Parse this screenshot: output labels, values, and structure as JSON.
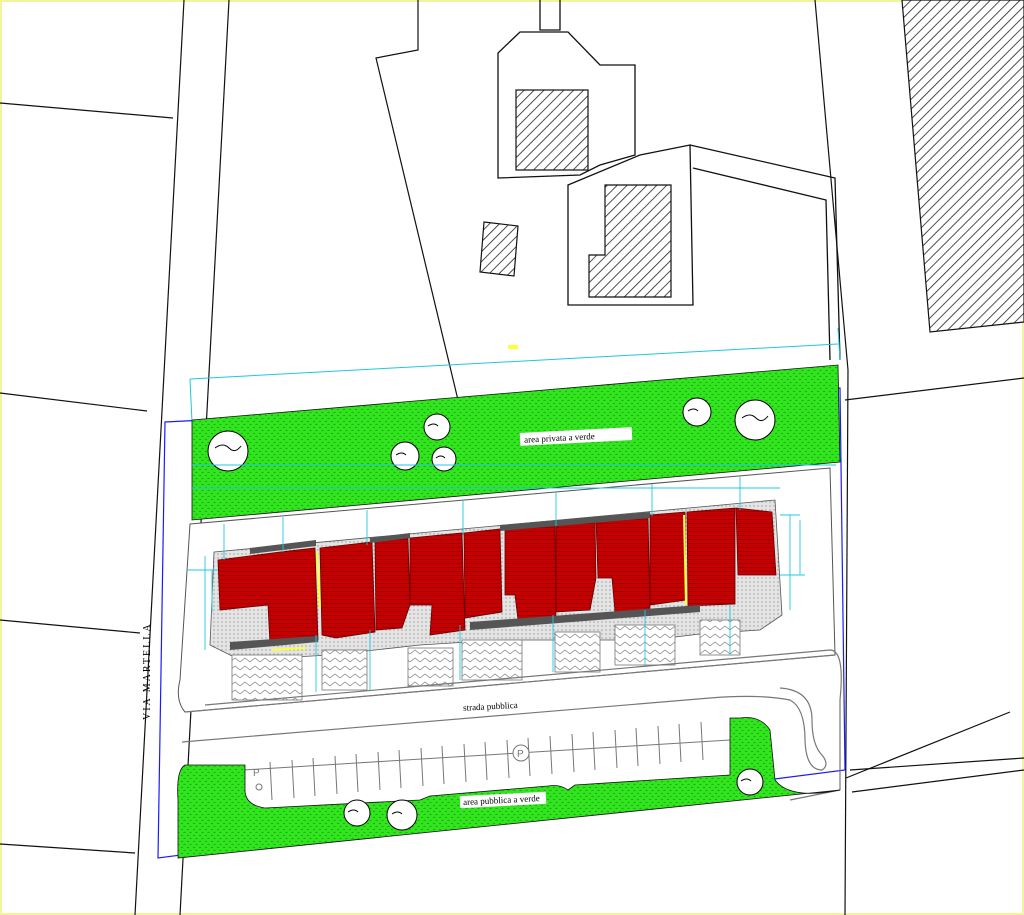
{
  "labels": {
    "street_name": "VIA MARTELLA",
    "private_green": "area privata a verde",
    "public_road": "strada pubblica",
    "public_green": "area pubblica a verde",
    "parking_symbol": "P"
  },
  "colors": {
    "frame": "#f5f39a",
    "lines": "#111111",
    "hatch": "#222222",
    "green": "#33e51f",
    "roof": "#c40000",
    "dimension": "#1ec8e0",
    "boundary": "#1a1aff",
    "paving": "#cfcfcf",
    "highlight": "#ffff33"
  },
  "icons": {
    "tree": "tree-icon",
    "parking": "parking-sign-icon"
  }
}
